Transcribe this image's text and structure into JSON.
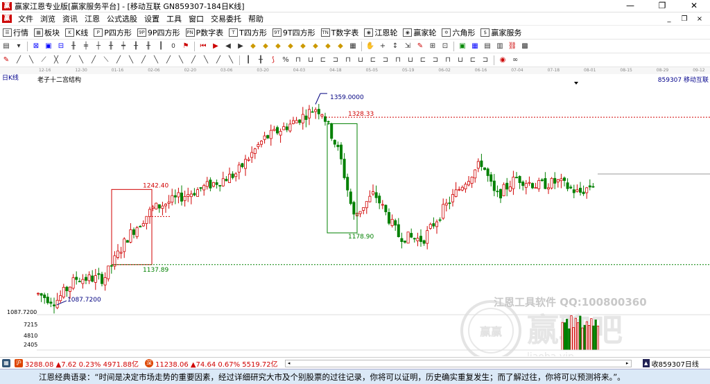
{
  "window": {
    "title": "赢家江恩专业版[赢家服务平台] - [移动互联  GN859307-184日K线]",
    "minimize": "—",
    "restore": "❐",
    "close": "✕"
  },
  "menu": {
    "items": [
      "文件",
      "浏览",
      "资讯",
      "江恩",
      "公式选股",
      "设置",
      "工具",
      "窗口",
      "交易委托",
      "帮助"
    ],
    "right": [
      "_",
      "❐",
      "×"
    ]
  },
  "toolbar1": {
    "items": [
      {
        "icon": "☰",
        "label": "行情"
      },
      {
        "icon": "▦",
        "label": "板块"
      },
      {
        "icon": "K",
        "label": "K线"
      },
      {
        "icon": "P",
        "label": "P四方形"
      },
      {
        "icon": "9P",
        "label": "9P四方形"
      },
      {
        "icon": "PN",
        "label": "P数字表"
      },
      {
        "icon": "T",
        "label": "T四方形"
      },
      {
        "icon": "9T",
        "label": "9T四方形"
      },
      {
        "icon": "TN",
        "label": "T数字表"
      },
      {
        "icon": "◉",
        "label": "江恩轮"
      },
      {
        "icon": "◉",
        "label": "赢家轮"
      },
      {
        "icon": "✡",
        "label": "六角形"
      },
      {
        "icon": "$",
        "label": "赢家服务"
      }
    ]
  },
  "datebar": [
    "12-16",
    "12-30",
    "01-16",
    "02-06",
    "02-20",
    "03-06",
    "03-20",
    "04-03",
    "04-18",
    "05-05",
    "05-19",
    "06-02",
    "06-16",
    "07-04",
    "07-18",
    "08-01",
    "08-15",
    "08-29",
    "09-12"
  ],
  "chart": {
    "period_label": "日K线",
    "structure_label": "老子十二宫结构",
    "code_label": "859307 移动互联",
    "y_labels": [
      "1087.7200",
      "7215",
      "4810",
      "2405"
    ],
    "watermark_software": "江恩工具软件  QQ:100800360",
    "watermark_brand": "赢聊吧",
    "watermark_url": "liaoba.vip"
  },
  "chart_data": {
    "type": "candlestick",
    "annotations": [
      {
        "label": "1359.0000",
        "value": 1359.0,
        "kind": "high"
      },
      {
        "label": "1328.33",
        "value": 1328.33,
        "kind": "resistance"
      },
      {
        "label": "1242.40",
        "value": 1242.4,
        "kind": "box-top"
      },
      {
        "label": "1178.90",
        "value": 1178.9,
        "kind": "box-bottom"
      },
      {
        "label": "1137.89",
        "value": 1137.89,
        "kind": "support"
      },
      {
        "label": "1087.7200",
        "value": 1087.72,
        "kind": "low"
      }
    ],
    "ylim": [
      1075,
      1375
    ],
    "volume_labels": [
      "7215",
      "4810",
      "2405"
    ]
  },
  "status": {
    "idx1": "3288.08 ▲7.62 0.23% 4971.88亿",
    "idx2": "11238.06 ▲74.64 0.67% 5519.72亿",
    "right": "收859307日线"
  },
  "quote": "江恩经典语录：“时间是决定市场走势的重要因素，经过详细研究大市及个别股票的过往记录，你将可以证明，历史确实重复发生；而了解过往，你将可以预测将来。”。",
  "colors": {
    "up": "#d00000",
    "down": "#008000",
    "annotation_high": "#000080"
  }
}
